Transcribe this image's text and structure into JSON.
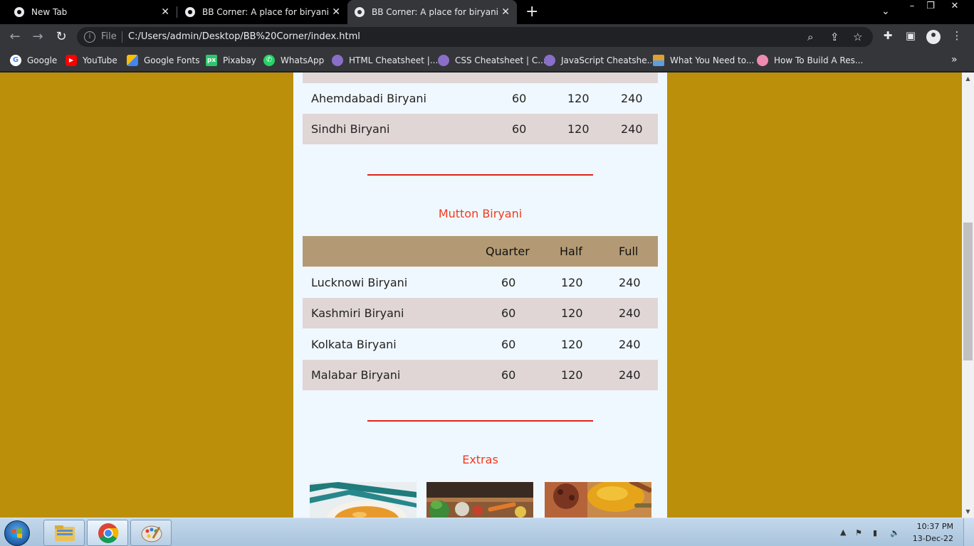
{
  "browser": {
    "tabs": [
      {
        "title": "New Tab",
        "active": false
      },
      {
        "title": "BB Corner: A place for biryani lov",
        "active": false
      },
      {
        "title": "BB Corner: A place for biryani lov",
        "active": true
      }
    ],
    "address": {
      "scheme_label": "File",
      "url": "C:/Users/admin/Desktop/BB%20Corner/index.html"
    },
    "bookmarks": [
      {
        "label": "Google",
        "icon": "google-icon",
        "color": "#ffffff"
      },
      {
        "label": "YouTube",
        "icon": "youtube-icon",
        "color": "#ff0000"
      },
      {
        "label": "Google Fonts",
        "icon": "google-fonts-icon",
        "color": "#4285f4"
      },
      {
        "label": "Pixabay",
        "icon": "pixabay-icon",
        "color": "#2ec66d"
      },
      {
        "label": "WhatsApp",
        "icon": "whatsapp-icon",
        "color": "#25d366"
      },
      {
        "label": "HTML Cheatsheet |...",
        "icon": "html-cheatsheet-icon",
        "color": "#8a6fc9"
      },
      {
        "label": "CSS Cheatsheet | C...",
        "icon": "css-cheatsheet-icon",
        "color": "#8a6fc9"
      },
      {
        "label": "JavaScript Cheatshe...",
        "icon": "javascript-cheatsheet-icon",
        "color": "#8a6fc9"
      },
      {
        "label": "What You Need to...",
        "icon": "article-icon",
        "color": "#e0a030"
      },
      {
        "label": "How To Build A Res...",
        "icon": "tutorial-icon",
        "color": "#f08bb0"
      }
    ]
  },
  "page": {
    "background_color": "#bb8f0a",
    "top_rows": [
      {
        "name": "Ahemdabadi Biryani",
        "quarter": "60",
        "half": "120",
        "full": "240"
      },
      {
        "name": "Sindhi Biryani",
        "quarter": "60",
        "half": "120",
        "full": "240"
      }
    ],
    "mutton": {
      "title": "Mutton Biryani",
      "columns": [
        "Quarter",
        "Half",
        "Full"
      ],
      "rows": [
        {
          "name": "Lucknowi Biryani",
          "quarter": "60",
          "half": "120",
          "full": "240"
        },
        {
          "name": "Kashmiri Biryani",
          "quarter": "60",
          "half": "120",
          "full": "240"
        },
        {
          "name": "Kolkata Biryani",
          "quarter": "60",
          "half": "120",
          "full": "240"
        },
        {
          "name": "Malabar Biryani",
          "quarter": "60",
          "half": "120",
          "full": "240"
        }
      ]
    },
    "extras": {
      "title": "Extras",
      "images": [
        "soup-photo",
        "vegetables-photo",
        "spices-photo"
      ]
    }
  },
  "taskbar": {
    "time": "10:37 PM",
    "date": "13-Dec-22"
  }
}
